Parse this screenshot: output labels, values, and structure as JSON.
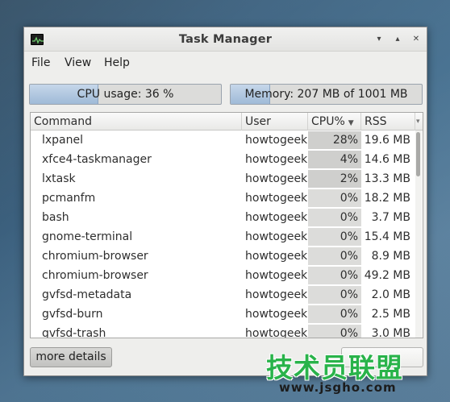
{
  "window": {
    "title": "Task Manager",
    "controls": {
      "minimize": "▾",
      "maximize": "▴",
      "close": "✕"
    }
  },
  "menu": [
    "File",
    "View",
    "Help"
  ],
  "cpu": {
    "label": "CPU usage: 36 %",
    "fraction": 0.36
  },
  "memory": {
    "label": "Memory: 207 MB of 1001 MB used",
    "fraction": 0.207
  },
  "table": {
    "columns": [
      "Command",
      "User",
      "CPU%",
      "RSS"
    ],
    "sort_indicator": "▼",
    "rows": [
      {
        "command": "lxpanel",
        "user": "howtogeek",
        "cpu": "28%",
        "cpu_value": 28,
        "rss": "19.6 MB"
      },
      {
        "command": "xfce4-taskmanager",
        "user": "howtogeek",
        "cpu": "4%",
        "cpu_value": 4,
        "rss": "14.6 MB"
      },
      {
        "command": "lxtask",
        "user": "howtogeek",
        "cpu": "2%",
        "cpu_value": 2,
        "rss": "13.3 MB"
      },
      {
        "command": "pcmanfm",
        "user": "howtogeek",
        "cpu": "0%",
        "cpu_value": 0,
        "rss": "18.2 MB"
      },
      {
        "command": "bash",
        "user": "howtogeek",
        "cpu": "0%",
        "cpu_value": 0,
        "rss": "3.7 MB"
      },
      {
        "command": "gnome-terminal",
        "user": "howtogeek",
        "cpu": "0%",
        "cpu_value": 0,
        "rss": "15.4 MB"
      },
      {
        "command": "chromium-browser",
        "user": "howtogeek",
        "cpu": "0%",
        "cpu_value": 0,
        "rss": "8.9 MB"
      },
      {
        "command": "chromium-browser",
        "user": "howtogeek",
        "cpu": "0%",
        "cpu_value": 0,
        "rss": "49.2 MB"
      },
      {
        "command": "gvfsd-metadata",
        "user": "howtogeek",
        "cpu": "0%",
        "cpu_value": 0,
        "rss": "2.0 MB"
      },
      {
        "command": "gvfsd-burn",
        "user": "howtogeek",
        "cpu": "0%",
        "cpu_value": 0,
        "rss": "2.5 MB"
      },
      {
        "command": "gvfsd-trash",
        "user": "howtogeek",
        "cpu": "0%",
        "cpu_value": 0,
        "rss": "3.0 MB"
      }
    ]
  },
  "buttons": {
    "more_details": "more details"
  },
  "watermark": {
    "text": "技术员联盟",
    "url": "www.jsgho.com"
  },
  "colors": {
    "accent": "#a8c2de",
    "watermark_green": "#29b34a"
  }
}
